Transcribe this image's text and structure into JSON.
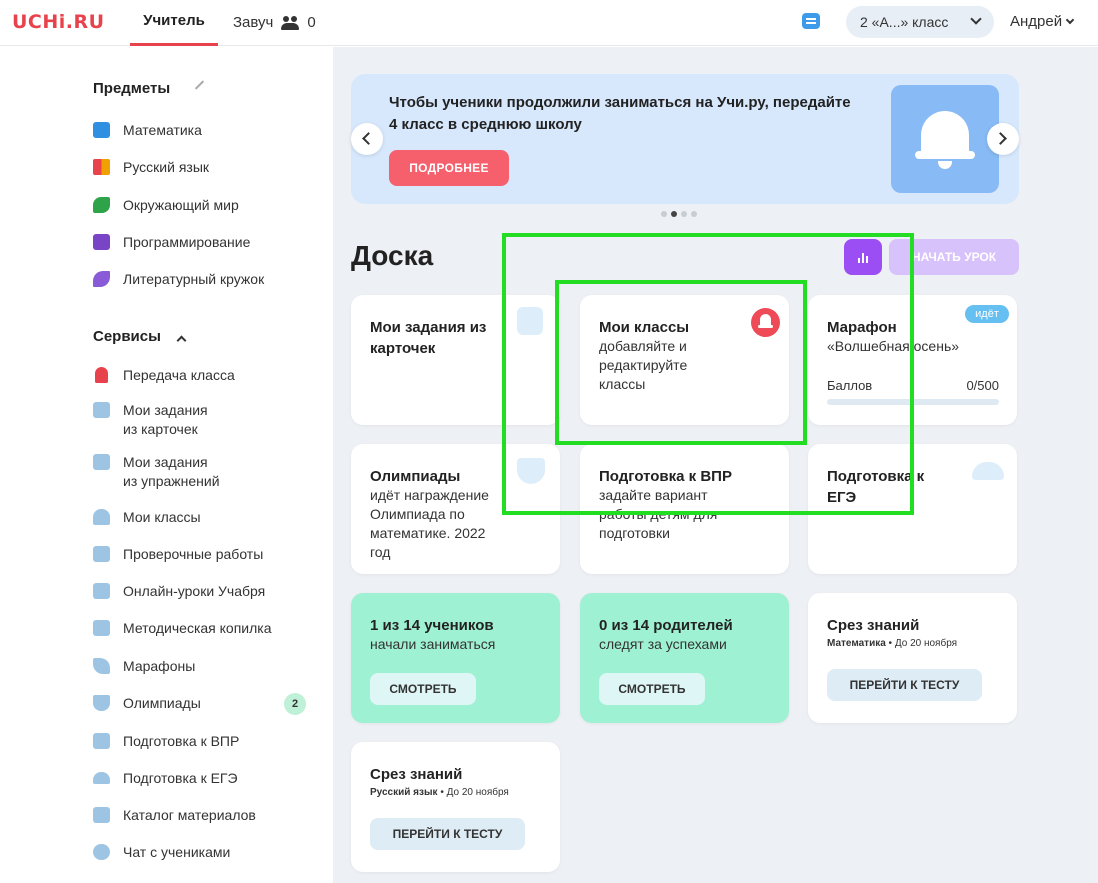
{
  "header": {
    "logo": "UCHi.RU",
    "tabs": [
      "Учитель",
      "Завуч"
    ],
    "zavuch_count": "0",
    "class_select": "2 «А...» класс",
    "user": "Андрей"
  },
  "sidebar": {
    "subjects_title": "Предметы",
    "subjects": [
      {
        "label": "Математика",
        "color": "#2f8fe0"
      },
      {
        "label": "Русский язык",
        "color": "#f0a000"
      },
      {
        "label": "Окружающий мир",
        "color": "#2fa34a"
      },
      {
        "label": "Программирование",
        "color": "#7a44c7"
      },
      {
        "label": "Литературный кружок",
        "color": "#8a5bd6"
      }
    ],
    "services_title": "Сервисы",
    "services": [
      {
        "label": "Передача класса",
        "color": "#e8434c"
      },
      {
        "label": "Мои задания\nиз карточек",
        "color": "#9dc5e3"
      },
      {
        "label": "Мои задания\nиз упражнений",
        "color": "#9dc5e3"
      },
      {
        "label": "Мои классы",
        "color": "#9dc5e3"
      },
      {
        "label": "Проверочные работы",
        "color": "#9dc5e3"
      },
      {
        "label": "Онлайн-уроки Учабря",
        "color": "#9dc5e3"
      },
      {
        "label": "Методическая копилка",
        "color": "#9dc5e3"
      },
      {
        "label": "Марафоны",
        "color": "#9dc5e3"
      },
      {
        "label": "Олимпиады",
        "color": "#9dc5e3"
      },
      {
        "label": "Подготовка к ВПР",
        "color": "#9dc5e3"
      },
      {
        "label": "Подготовка к ЕГЭ",
        "color": "#9dc5e3"
      },
      {
        "label": "Каталог материалов",
        "color": "#9dc5e3"
      },
      {
        "label": "Чат с учениками",
        "color": "#9dc5e3"
      }
    ],
    "olympiad_badge": "2"
  },
  "banner": {
    "text": "Чтобы ученики продолжили заниматься на Учи.ру, передайте 4 класс в среднюю школу",
    "button": "ПОДРОБНЕЕ",
    "active_slide": 2,
    "slide_count": 4
  },
  "board": {
    "title": "Доска",
    "start_lesson": "НАЧАТЬ УРОК"
  },
  "cards": {
    "my_tasks": {
      "title": "Мои задания из карточек"
    },
    "my_classes": {
      "title": "Мои классы",
      "sub": "добавляйте и редактируйте классы"
    },
    "marathon": {
      "title": "Марафон",
      "sub": "«Волшебная осень»",
      "badge": "идёт",
      "score_label": "Баллов",
      "score": "0/500",
      "progress": 0
    },
    "olympiads": {
      "title": "Олимпиады",
      "sub": "идёт награждение Олимпиада по математике. 2022 год"
    },
    "vpr": {
      "title": "Подготовка к ВПР",
      "sub": "задайте вариант работы детям для подготовки"
    },
    "ege": {
      "title": "Подготовка к ЕГЭ"
    },
    "students": {
      "title": "1 из 14 учеников",
      "sub": "начали заниматься",
      "button": "СМОТРЕТЬ"
    },
    "parents": {
      "title": "0 из 14 родителей",
      "sub": "следят за успехами",
      "button": "СМОТРЕТЬ"
    },
    "test_math": {
      "title": "Срез знаний",
      "subject": "Математика",
      "due": " • До 20 ноября",
      "button": "ПЕРЕЙТИ К ТЕСТУ"
    },
    "test_rus": {
      "title": "Срез знаний",
      "subject": "Русский язык",
      "due": " • До 20 ноября",
      "button": "ПЕРЕЙТИ К ТЕСТУ"
    }
  }
}
